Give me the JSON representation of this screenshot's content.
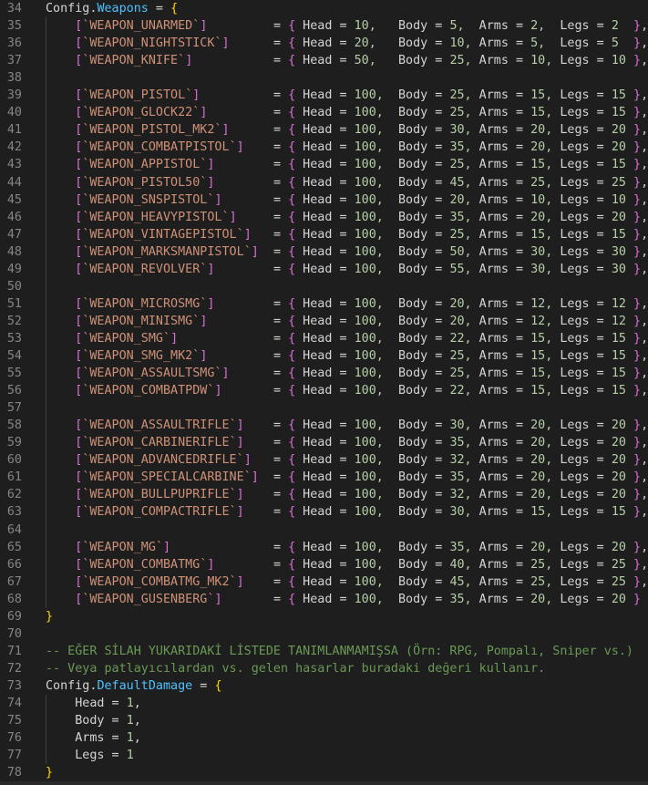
{
  "editor": {
    "lines": [
      {
        "n": "34",
        "t": "decl_open",
        "obj": "Config",
        "prop": "Weapons"
      },
      {
        "n": "35",
        "t": "weapon",
        "name": "WEAPON_UNARMED",
        "head": "10,",
        "body": "5,",
        "arms": "2,",
        "legs": "2",
        "tail": "},"
      },
      {
        "n": "36",
        "t": "weapon",
        "name": "WEAPON_NIGHTSTICK",
        "head": "20,",
        "body": "10,",
        "arms": "5,",
        "legs": "5",
        "tail": "},"
      },
      {
        "n": "37",
        "t": "weapon",
        "name": "WEAPON_KNIFE",
        "head": "50,",
        "body": "25,",
        "arms": "10,",
        "legs": "10",
        "tail": "},"
      },
      {
        "n": "38",
        "t": "blank"
      },
      {
        "n": "39",
        "t": "weapon",
        "name": "WEAPON_PISTOL",
        "head": "100,",
        "body": "25,",
        "arms": "15,",
        "legs": "15",
        "tail": "},"
      },
      {
        "n": "40",
        "t": "weapon",
        "name": "WEAPON_GLOCK22",
        "head": "100,",
        "body": "25,",
        "arms": "15,",
        "legs": "15",
        "tail": "},"
      },
      {
        "n": "41",
        "t": "weapon",
        "name": "WEAPON_PISTOL_MK2",
        "head": "100,",
        "body": "30,",
        "arms": "20,",
        "legs": "20",
        "tail": "},"
      },
      {
        "n": "42",
        "t": "weapon",
        "name": "WEAPON_COMBATPISTOL",
        "head": "100,",
        "body": "35,",
        "arms": "20,",
        "legs": "20",
        "tail": "},"
      },
      {
        "n": "43",
        "t": "weapon",
        "name": "WEAPON_APPISTOL",
        "head": "100,",
        "body": "25,",
        "arms": "15,",
        "legs": "15",
        "tail": "},"
      },
      {
        "n": "44",
        "t": "weapon",
        "name": "WEAPON_PISTOL50",
        "head": "100,",
        "body": "45,",
        "arms": "25,",
        "legs": "25",
        "tail": "},"
      },
      {
        "n": "45",
        "t": "weapon",
        "name": "WEAPON_SNSPISTOL",
        "head": "100,",
        "body": "20,",
        "arms": "10,",
        "legs": "10",
        "tail": "},"
      },
      {
        "n": "46",
        "t": "weapon",
        "name": "WEAPON_HEAVYPISTOL",
        "head": "100,",
        "body": "35,",
        "arms": "20,",
        "legs": "20",
        "tail": "},"
      },
      {
        "n": "47",
        "t": "weapon",
        "name": "WEAPON_VINTAGEPISTOL",
        "head": "100,",
        "body": "25,",
        "arms": "15,",
        "legs": "15",
        "tail": "},"
      },
      {
        "n": "48",
        "t": "weapon",
        "name": "WEAPON_MARKSMANPISTOL",
        "head": "100,",
        "body": "50,",
        "arms": "30,",
        "legs": "30",
        "tail": "},"
      },
      {
        "n": "49",
        "t": "weapon",
        "name": "WEAPON_REVOLVER",
        "head": "100,",
        "body": "55,",
        "arms": "30,",
        "legs": "30",
        "tail": "},"
      },
      {
        "n": "50",
        "t": "blank"
      },
      {
        "n": "51",
        "t": "weapon",
        "name": "WEAPON_MICROSMG",
        "head": "100,",
        "body": "20,",
        "arms": "12,",
        "legs": "12",
        "tail": "},"
      },
      {
        "n": "52",
        "t": "weapon",
        "name": "WEAPON_MINISMG",
        "head": "100,",
        "body": "20,",
        "arms": "12,",
        "legs": "12",
        "tail": "},"
      },
      {
        "n": "53",
        "t": "weapon",
        "name": "WEAPON_SMG",
        "head": "100,",
        "body": "22,",
        "arms": "15,",
        "legs": "15",
        "tail": "},"
      },
      {
        "n": "54",
        "t": "weapon",
        "name": "WEAPON_SMG_MK2",
        "head": "100,",
        "body": "25,",
        "arms": "15,",
        "legs": "15",
        "tail": "},"
      },
      {
        "n": "55",
        "t": "weapon",
        "name": "WEAPON_ASSAULTSMG",
        "head": "100,",
        "body": "25,",
        "arms": "15,",
        "legs": "15",
        "tail": "},"
      },
      {
        "n": "56",
        "t": "weapon",
        "name": "WEAPON_COMBATPDW",
        "head": "100,",
        "body": "22,",
        "arms": "15,",
        "legs": "15",
        "tail": "},"
      },
      {
        "n": "57",
        "t": "blank"
      },
      {
        "n": "58",
        "t": "weapon",
        "name": "WEAPON_ASSAULTRIFLE",
        "head": "100,",
        "body": "30,",
        "arms": "20,",
        "legs": "20",
        "tail": "},"
      },
      {
        "n": "59",
        "t": "weapon",
        "name": "WEAPON_CARBINERIFLE",
        "head": "100,",
        "body": "35,",
        "arms": "20,",
        "legs": "20",
        "tail": "},"
      },
      {
        "n": "60",
        "t": "weapon",
        "name": "WEAPON_ADVANCEDRIFLE",
        "head": "100,",
        "body": "32,",
        "arms": "20,",
        "legs": "20",
        "tail": "},"
      },
      {
        "n": "61",
        "t": "weapon",
        "name": "WEAPON_SPECIALCARBINE",
        "head": "100,",
        "body": "35,",
        "arms": "20,",
        "legs": "20",
        "tail": "},"
      },
      {
        "n": "62",
        "t": "weapon",
        "name": "WEAPON_BULLPUPRIFLE",
        "head": "100,",
        "body": "32,",
        "arms": "20,",
        "legs": "20",
        "tail": "},"
      },
      {
        "n": "63",
        "t": "weapon",
        "name": "WEAPON_COMPACTRIFLE",
        "head": "100,",
        "body": "30,",
        "arms": "15,",
        "legs": "15",
        "tail": "},"
      },
      {
        "n": "64",
        "t": "blank"
      },
      {
        "n": "65",
        "t": "weapon",
        "name": "WEAPON_MG",
        "head": "100,",
        "body": "35,",
        "arms": "20,",
        "legs": "20",
        "tail": "},"
      },
      {
        "n": "66",
        "t": "weapon",
        "name": "WEAPON_COMBATMG",
        "head": "100,",
        "body": "40,",
        "arms": "25,",
        "legs": "25",
        "tail": "},"
      },
      {
        "n": "67",
        "t": "weapon",
        "name": "WEAPON_COMBATMG_MK2",
        "head": "100,",
        "body": "45,",
        "arms": "25,",
        "legs": "25",
        "tail": "},"
      },
      {
        "n": "68",
        "t": "weapon",
        "name": "WEAPON_GUSENBERG",
        "head": "100,",
        "body": "35,",
        "arms": "20,",
        "legs": "20",
        "tail": "}"
      },
      {
        "n": "69",
        "t": "close"
      },
      {
        "n": "70",
        "t": "blank"
      },
      {
        "n": "71",
        "t": "comment",
        "text": "-- EĞER SİLAH YUKARIDAKİ LİSTEDE TANIMLANMAMIŞSA (Örn: RPG, Pompalı, Sniper vs.)"
      },
      {
        "n": "72",
        "t": "comment",
        "text": "-- Veya patlayıcılardan vs. gelen hasarlar buradaki değeri kullanır."
      },
      {
        "n": "73",
        "t": "decl_open",
        "obj": "Config",
        "prop": "DefaultDamage"
      },
      {
        "n": "74",
        "t": "field",
        "key": "Head",
        "val": "1",
        "sep": ","
      },
      {
        "n": "75",
        "t": "field",
        "key": "Body",
        "val": "1",
        "sep": ","
      },
      {
        "n": "76",
        "t": "field",
        "key": "Arms",
        "val": "1",
        "sep": ","
      },
      {
        "n": "77",
        "t": "field",
        "key": "Legs",
        "val": "1",
        "sep": ""
      },
      {
        "n": "78",
        "t": "close"
      }
    ]
  },
  "theme": {
    "background": "#1e1e1e",
    "line_number": "#858585",
    "property": "#4fc1ff",
    "brace": "#ffd700",
    "bracket": "#da70d6",
    "string": "#ce9178",
    "number": "#b5cea8",
    "comment": "#6a9955"
  }
}
